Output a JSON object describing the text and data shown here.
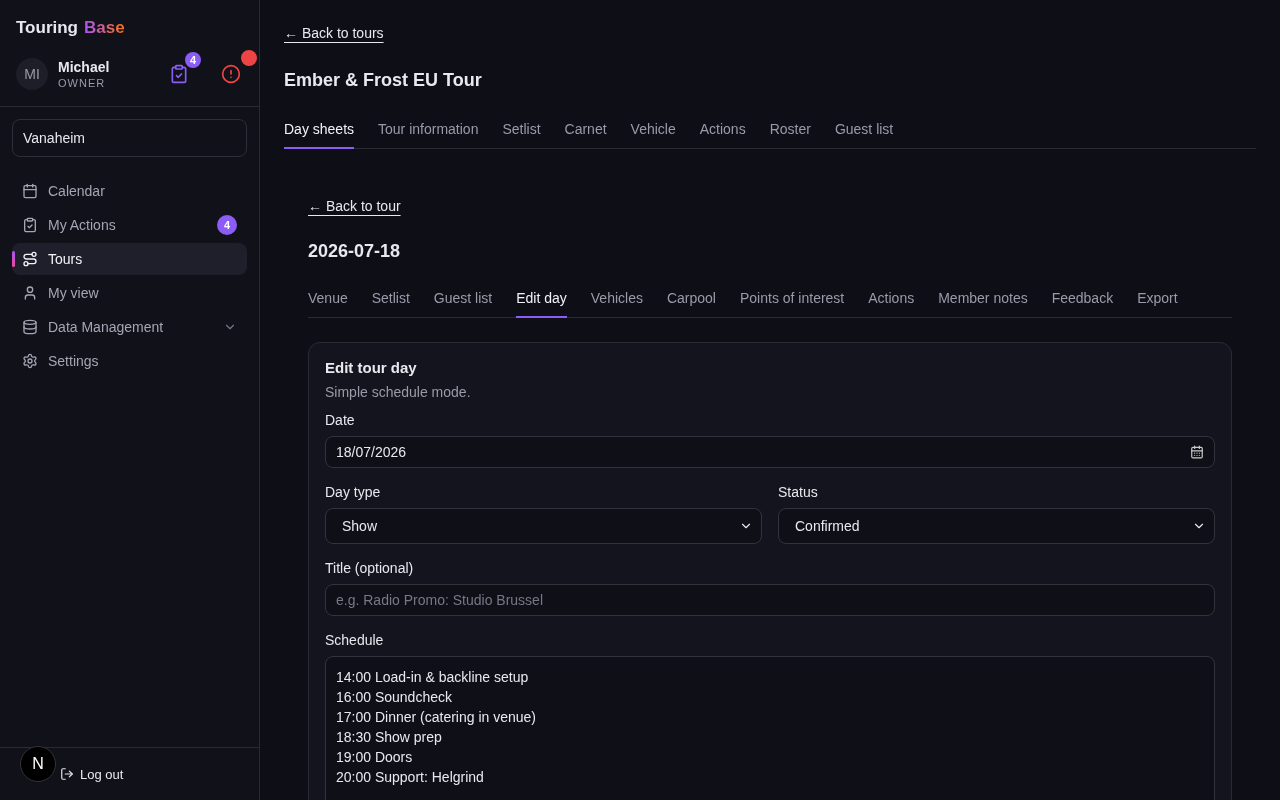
{
  "brand": {
    "name": "Touring",
    "accent": "Base"
  },
  "user": {
    "initials": "MI",
    "name": "Michael",
    "role": "OWNER",
    "actions_count": "4",
    "alert": true
  },
  "workspace": "Vanaheim",
  "nav": [
    {
      "label": "Calendar",
      "selected": false
    },
    {
      "label": "My Actions",
      "selected": false,
      "badge": "4"
    },
    {
      "label": "Tours",
      "selected": true
    },
    {
      "label": "My view",
      "selected": false
    },
    {
      "label": "Data Management",
      "selected": false,
      "expanded": false
    },
    {
      "label": "Settings",
      "selected": false
    }
  ],
  "logout": "Log out",
  "dev_badge": "N",
  "back_link": "← Back to tours",
  "tour_title": "Ember & Frost EU Tour",
  "tour_tabs": [
    {
      "label": "Day sheets",
      "selected": true
    },
    {
      "label": "Tour information",
      "selected": false
    },
    {
      "label": "Setlist",
      "selected": false
    },
    {
      "label": "Carnet",
      "selected": false
    },
    {
      "label": "Vehicle",
      "selected": false
    },
    {
      "label": "Actions",
      "selected": false
    },
    {
      "label": "Roster",
      "selected": false
    },
    {
      "label": "Guest list",
      "selected": false
    }
  ],
  "day": {
    "back_link": "← Back to tour",
    "title": "2026-07-18",
    "tabs": [
      {
        "label": "Venue",
        "selected": false
      },
      {
        "label": "Setlist",
        "selected": false
      },
      {
        "label": "Guest list",
        "selected": false
      },
      {
        "label": "Edit day",
        "selected": true
      },
      {
        "label": "Vehicles",
        "selected": false
      },
      {
        "label": "Carpool",
        "selected": false
      },
      {
        "label": "Points of interest",
        "selected": false
      },
      {
        "label": "Actions",
        "selected": false
      },
      {
        "label": "Member notes",
        "selected": false
      },
      {
        "label": "Feedback",
        "selected": false
      },
      {
        "label": "Export",
        "selected": false
      }
    ],
    "form": {
      "title": "Edit tour day",
      "subtitle": "Simple schedule mode.",
      "date": {
        "label": "Date",
        "value": "18/07/2026"
      },
      "day_type": {
        "label": "Day type",
        "value": "Show"
      },
      "status": {
        "label": "Status",
        "value": "Confirmed"
      },
      "title_field": {
        "label": "Title (optional)",
        "placeholder": "e.g. Radio Promo: Studio Brussel"
      },
      "schedule": {
        "label": "Schedule",
        "lines": [
          "14:00 Load-in & backline setup",
          "16:00 Soundcheck",
          "17:00 Dinner (catering in venue)",
          "18:30 Show prep",
          "19:00 Doors",
          "20:00 Support: Helgrind"
        ]
      }
    }
  }
}
